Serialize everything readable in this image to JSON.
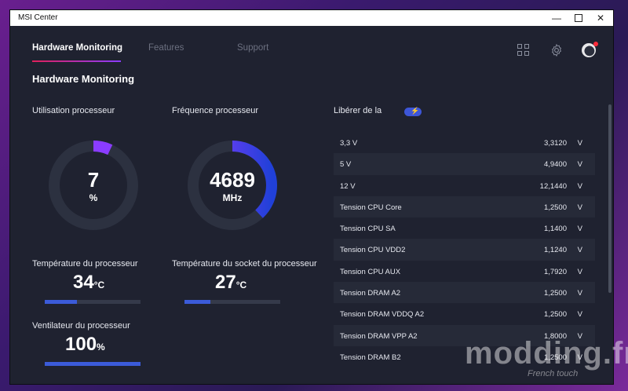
{
  "window": {
    "title": "MSI Center"
  },
  "nav": {
    "tabs": [
      "Hardware Monitoring",
      "Features",
      "Support"
    ],
    "active_index": 0
  },
  "section_title": "Hardware Monitoring",
  "cpu_usage": {
    "label": "Utilisation processeur",
    "value": "7",
    "unit": "%",
    "fraction": 0.07
  },
  "cpu_freq": {
    "label": "Fréquence processeur",
    "value": "4689",
    "unit": "MHz",
    "fraction": 0.38
  },
  "cpu_temp": {
    "label": "Température du processeur",
    "value": "34",
    "unit": "°C",
    "fraction": 0.34
  },
  "socket_temp": {
    "label": "Température du socket du processeur",
    "value": "27",
    "unit": "°C",
    "fraction": 0.27
  },
  "cpu_fan": {
    "label": "Ventilateur du processeur",
    "value": "100",
    "unit": "%",
    "fraction": 1.0
  },
  "voltages": {
    "header": "Libérer de la",
    "rows": [
      {
        "name": "3,3 V",
        "value": "3,3120",
        "unit": "V"
      },
      {
        "name": "5 V",
        "value": "4,9400",
        "unit": "V"
      },
      {
        "name": "12 V",
        "value": "12,1440",
        "unit": "V"
      },
      {
        "name": "Tension CPU Core",
        "value": "1,2500",
        "unit": "V"
      },
      {
        "name": "Tension CPU SA",
        "value": "1,1400",
        "unit": "V"
      },
      {
        "name": "Tension CPU VDD2",
        "value": "1,1240",
        "unit": "V"
      },
      {
        "name": "Tension CPU AUX",
        "value": "1,7920",
        "unit": "V"
      },
      {
        "name": "Tension DRAM A2",
        "value": "1,2500",
        "unit": "V"
      },
      {
        "name": "Tension DRAM VDDQ A2",
        "value": "1,2500",
        "unit": "V"
      },
      {
        "name": "Tension DRAM VPP A2",
        "value": "1,8000",
        "unit": "V"
      },
      {
        "name": "Tension DRAM B2",
        "value": "1,2500",
        "unit": "V"
      }
    ]
  },
  "colors": {
    "accent": "#3b5bd9",
    "gauge_track": "#2c3140",
    "gauge_start": "#8a3cff",
    "gauge_end": "#2040d8"
  },
  "watermark": {
    "text": "modding.fr",
    "sub": "French touch"
  }
}
